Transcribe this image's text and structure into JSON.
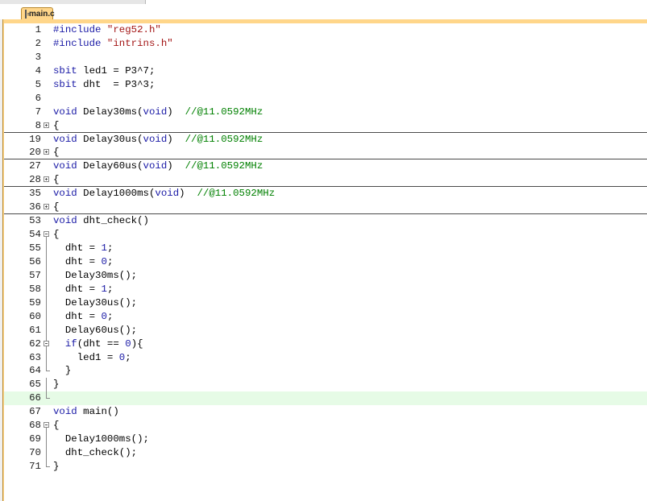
{
  "tab": {
    "label": "main.c"
  },
  "lines": [
    {
      "n": "1",
      "fold": "",
      "sep": false,
      "hl": false,
      "tokens": [
        [
          "pp",
          "#include "
        ],
        [
          "str",
          "\"reg52.h\""
        ]
      ]
    },
    {
      "n": "2",
      "fold": "",
      "sep": false,
      "hl": false,
      "tokens": [
        [
          "pp",
          "#include "
        ],
        [
          "str",
          "\"intrins.h\""
        ]
      ]
    },
    {
      "n": "3",
      "fold": "",
      "sep": false,
      "hl": false,
      "tokens": []
    },
    {
      "n": "4",
      "fold": "",
      "sep": false,
      "hl": false,
      "tokens": [
        [
          "kw",
          "sbit"
        ],
        [
          "t",
          " led1 = P3^7;"
        ]
      ]
    },
    {
      "n": "5",
      "fold": "",
      "sep": false,
      "hl": false,
      "tokens": [
        [
          "kw",
          "sbit"
        ],
        [
          "t",
          " dht  = P3^3;"
        ]
      ]
    },
    {
      "n": "6",
      "fold": "",
      "sep": false,
      "hl": false,
      "tokens": []
    },
    {
      "n": "7",
      "fold": "",
      "sep": false,
      "hl": false,
      "tokens": [
        [
          "kw",
          "void"
        ],
        [
          "t",
          " Delay30ms("
        ],
        [
          "kw",
          "void"
        ],
        [
          "t",
          ")  "
        ],
        [
          "cmt",
          "//@11.0592MHz"
        ]
      ]
    },
    {
      "n": "8",
      "fold": "plus",
      "sep": true,
      "hl": false,
      "tokens": [
        [
          "t",
          "{"
        ]
      ]
    },
    {
      "n": "19",
      "fold": "",
      "sep": false,
      "hl": false,
      "tokens": [
        [
          "kw",
          "void"
        ],
        [
          "t",
          " Delay30us("
        ],
        [
          "kw",
          "void"
        ],
        [
          "t",
          ")  "
        ],
        [
          "cmt",
          "//@11.0592MHz"
        ]
      ]
    },
    {
      "n": "20",
      "fold": "plus",
      "sep": true,
      "hl": false,
      "tokens": [
        [
          "t",
          "{"
        ]
      ]
    },
    {
      "n": "27",
      "fold": "",
      "sep": false,
      "hl": false,
      "tokens": [
        [
          "kw",
          "void"
        ],
        [
          "t",
          " Delay60us("
        ],
        [
          "kw",
          "void"
        ],
        [
          "t",
          ")  "
        ],
        [
          "cmt",
          "//@11.0592MHz"
        ]
      ]
    },
    {
      "n": "28",
      "fold": "plus",
      "sep": true,
      "hl": false,
      "tokens": [
        [
          "t",
          "{"
        ]
      ]
    },
    {
      "n": "35",
      "fold": "",
      "sep": false,
      "hl": false,
      "tokens": [
        [
          "kw",
          "void"
        ],
        [
          "t",
          " Delay1000ms("
        ],
        [
          "kw",
          "void"
        ],
        [
          "t",
          ")  "
        ],
        [
          "cmt",
          "//@11.0592MHz"
        ]
      ]
    },
    {
      "n": "36",
      "fold": "plus",
      "sep": true,
      "hl": false,
      "tokens": [
        [
          "t",
          "{"
        ]
      ]
    },
    {
      "n": "53",
      "fold": "",
      "sep": false,
      "hl": false,
      "tokens": [
        [
          "kw",
          "void"
        ],
        [
          "t",
          " dht_check()"
        ]
      ]
    },
    {
      "n": "54",
      "fold": "minus",
      "sep": false,
      "hl": false,
      "tokens": [
        [
          "t",
          "{"
        ]
      ]
    },
    {
      "n": "55",
      "fold": "line",
      "sep": false,
      "hl": false,
      "tokens": [
        [
          "t",
          "  dht = "
        ],
        [
          "num",
          "1"
        ],
        [
          "t",
          ";"
        ]
      ]
    },
    {
      "n": "56",
      "fold": "line",
      "sep": false,
      "hl": false,
      "tokens": [
        [
          "t",
          "  dht = "
        ],
        [
          "num",
          "0"
        ],
        [
          "t",
          ";"
        ]
      ]
    },
    {
      "n": "57",
      "fold": "line",
      "sep": false,
      "hl": false,
      "tokens": [
        [
          "t",
          "  Delay30ms();"
        ]
      ]
    },
    {
      "n": "58",
      "fold": "line",
      "sep": false,
      "hl": false,
      "tokens": [
        [
          "t",
          "  dht = "
        ],
        [
          "num",
          "1"
        ],
        [
          "t",
          ";"
        ]
      ]
    },
    {
      "n": "59",
      "fold": "line",
      "sep": false,
      "hl": false,
      "tokens": [
        [
          "t",
          "  Delay30us();"
        ]
      ]
    },
    {
      "n": "60",
      "fold": "line",
      "sep": false,
      "hl": false,
      "tokens": [
        [
          "t",
          "  dht = "
        ],
        [
          "num",
          "0"
        ],
        [
          "t",
          ";"
        ]
      ]
    },
    {
      "n": "61",
      "fold": "line",
      "sep": false,
      "hl": false,
      "tokens": [
        [
          "t",
          "  Delay60us();"
        ]
      ]
    },
    {
      "n": "62",
      "fold": "minus-inner",
      "sep": false,
      "hl": false,
      "tokens": [
        [
          "t",
          "  "
        ],
        [
          "kw",
          "if"
        ],
        [
          "t",
          "(dht == "
        ],
        [
          "num",
          "0"
        ],
        [
          "t",
          "){"
        ]
      ]
    },
    {
      "n": "63",
      "fold": "line",
      "sep": false,
      "hl": false,
      "tokens": [
        [
          "t",
          "    led1 = "
        ],
        [
          "num",
          "0"
        ],
        [
          "t",
          ";"
        ]
      ]
    },
    {
      "n": "64",
      "fold": "end-inner",
      "sep": false,
      "hl": false,
      "tokens": [
        [
          "t",
          "  }"
        ]
      ]
    },
    {
      "n": "65",
      "fold": "line",
      "sep": false,
      "hl": false,
      "tokens": [
        [
          "t",
          "}"
        ]
      ]
    },
    {
      "n": "66",
      "fold": "end",
      "sep": false,
      "hl": true,
      "tokens": []
    },
    {
      "n": "67",
      "fold": "",
      "sep": false,
      "hl": false,
      "tokens": [
        [
          "kw",
          "void"
        ],
        [
          "t",
          " main()"
        ]
      ]
    },
    {
      "n": "68",
      "fold": "minus",
      "sep": false,
      "hl": false,
      "tokens": [
        [
          "t",
          "{"
        ]
      ]
    },
    {
      "n": "69",
      "fold": "line",
      "sep": false,
      "hl": false,
      "tokens": [
        [
          "t",
          "  Delay1000ms();"
        ]
      ]
    },
    {
      "n": "70",
      "fold": "line",
      "sep": false,
      "hl": false,
      "tokens": [
        [
          "t",
          "  dht_check();"
        ]
      ]
    },
    {
      "n": "71",
      "fold": "end",
      "sep": false,
      "hl": false,
      "tokens": [
        [
          "t",
          "}"
        ]
      ]
    }
  ]
}
